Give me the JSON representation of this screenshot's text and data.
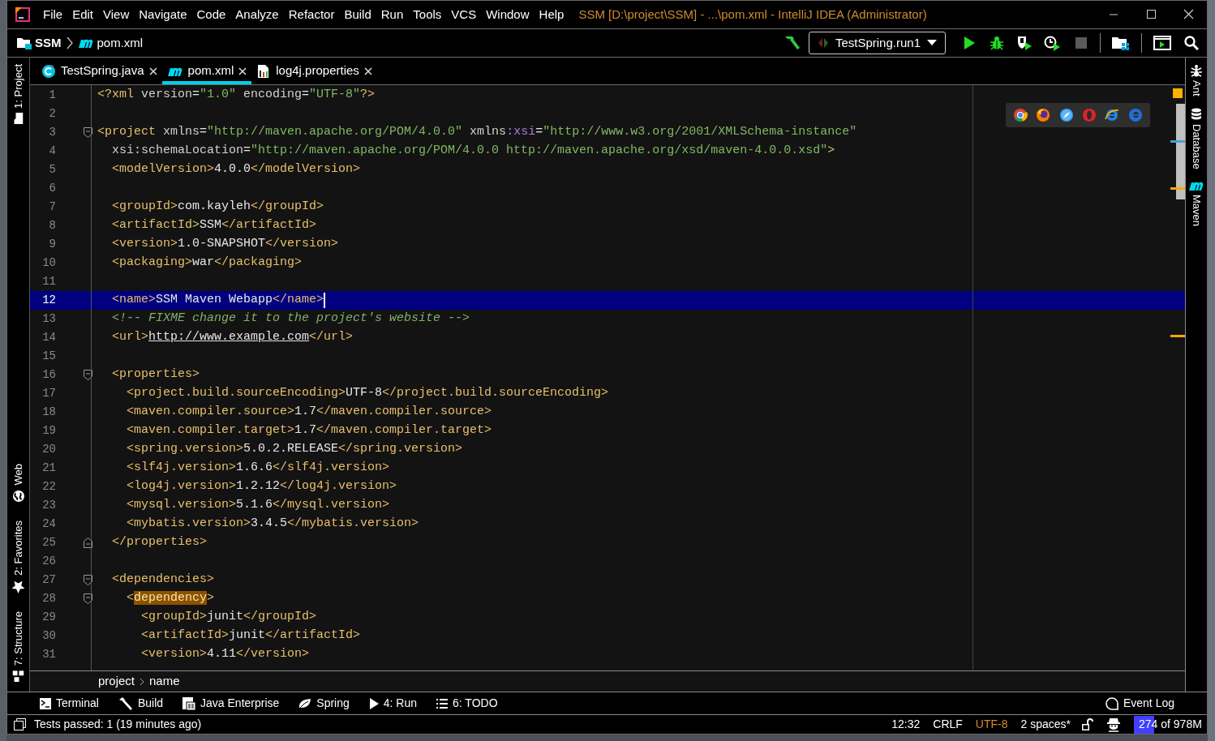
{
  "title_bar": {
    "menu": [
      "File",
      "Edit",
      "View",
      "Navigate",
      "Code",
      "Analyze",
      "Refactor",
      "Build",
      "Run",
      "Tools",
      "VCS",
      "Window",
      "Help"
    ],
    "title": "SSM [D:\\project\\SSM] - ...\\pom.xml - IntelliJ IDEA (Administrator)"
  },
  "nav_bar": {
    "project": "SSM",
    "file": "pom.xml",
    "run_config": "TestSpring.run1",
    "toolbar": [
      {
        "kind": "build",
        "disabled": false
      },
      {
        "kind": "config"
      },
      {
        "kind": "run",
        "disabled": false
      },
      {
        "kind": "debug",
        "disabled": false
      },
      {
        "kind": "coverage",
        "disabled": false
      },
      {
        "kind": "profile",
        "disabled": false
      },
      {
        "kind": "stop",
        "disabled": true
      },
      {
        "kind": "sep"
      },
      {
        "kind": "structure"
      },
      {
        "kind": "sep"
      },
      {
        "kind": "terminal"
      },
      {
        "kind": "search"
      }
    ]
  },
  "tabs": [
    {
      "label": "TestSpring.java",
      "kind": "java",
      "selected": false
    },
    {
      "label": "pom.xml",
      "kind": "maven",
      "selected": true
    },
    {
      "label": "log4j.properties",
      "kind": "properties",
      "selected": false
    }
  ],
  "left_tool_strip": {
    "top": [
      {
        "label": "1: Project",
        "kind": "project"
      }
    ],
    "bottom": [
      {
        "label": "Web",
        "kind": "web"
      },
      {
        "label": "2: Favorites",
        "kind": "favorites"
      },
      {
        "label": "7: Structure",
        "kind": "structure"
      }
    ]
  },
  "right_tool_strip": [
    {
      "label": "Ant",
      "kind": "ant"
    },
    {
      "label": "Database",
      "kind": "database"
    },
    {
      "label": "Maven",
      "kind": "maven"
    }
  ],
  "editor": {
    "browsers": [
      {
        "kind": "chrome"
      },
      {
        "kind": "firefox"
      },
      {
        "kind": "safari"
      },
      {
        "kind": "opera"
      },
      {
        "kind": "ie"
      },
      {
        "kind": "edge"
      }
    ],
    "lines": [
      {
        "number": "1",
        "current": false,
        "caret": false,
        "tokens": [
          {
            "kind": "tag",
            "text": "<?xml "
          },
          {
            "kind": "attr",
            "text": "version"
          },
          {
            "kind": "text",
            "text": "="
          },
          {
            "kind": "value",
            "text": "\"1.0\" "
          },
          {
            "kind": "attr",
            "text": "encoding"
          },
          {
            "kind": "text",
            "text": "="
          },
          {
            "kind": "value",
            "text": "\"UTF-8\""
          },
          {
            "kind": "tag",
            "text": "?>"
          }
        ]
      },
      {
        "number": "2",
        "current": false,
        "caret": false
      },
      {
        "number": "3",
        "kind": "fold_start",
        "current": false,
        "caret": false,
        "tokens": [
          {
            "kind": "tag",
            "text": "<project "
          },
          {
            "kind": "attr",
            "text": "xmlns"
          },
          {
            "kind": "text",
            "text": "="
          },
          {
            "kind": "value",
            "text": "\"http://maven.apache.org/POM/4.0.0\" "
          },
          {
            "kind": "attr",
            "text": "xmlns"
          },
          {
            "kind": "ns",
            "text": ":xsi"
          },
          {
            "kind": "text",
            "text": "="
          },
          {
            "kind": "value",
            "text": "\"http://www.w3.org/2001/XMLSchema-instance\""
          }
        ]
      },
      {
        "number": "4",
        "current": false,
        "caret": false,
        "tokens": [
          {
            "kind": "attr",
            "text": "  xsi:schemaLocation"
          },
          {
            "kind": "text",
            "text": "="
          },
          {
            "kind": "value",
            "text": "\"http://maven.apache.org/POM/4.0.0 http://maven.apache.org/xsd/maven-4.0.0.xsd\""
          },
          {
            "kind": "tag",
            "text": ">"
          }
        ]
      },
      {
        "number": "5",
        "current": false,
        "caret": false,
        "tokens": [
          {
            "kind": "tag",
            "text": "  <modelVersion>"
          },
          {
            "kind": "text",
            "text": "4.0.0"
          },
          {
            "kind": "tag",
            "text": "</modelVersion>"
          }
        ]
      },
      {
        "number": "6",
        "current": false,
        "caret": false
      },
      {
        "number": "7",
        "current": false,
        "caret": false,
        "tokens": [
          {
            "kind": "tag",
            "text": "  <groupId>"
          },
          {
            "kind": "text",
            "text": "com.kayleh"
          },
          {
            "kind": "tag",
            "text": "</groupId>"
          }
        ]
      },
      {
        "number": "8",
        "current": false,
        "caret": false,
        "tokens": [
          {
            "kind": "tag",
            "text": "  <artifactId>"
          },
          {
            "kind": "text",
            "text": "SSM"
          },
          {
            "kind": "tag",
            "text": "</artifactId>"
          }
        ]
      },
      {
        "number": "9",
        "current": false,
        "caret": false,
        "tokens": [
          {
            "kind": "tag",
            "text": "  <version>"
          },
          {
            "kind": "text",
            "text": "1.0-SNAPSHOT"
          },
          {
            "kind": "tag",
            "text": "</version>"
          }
        ]
      },
      {
        "number": "10",
        "current": false,
        "caret": false,
        "tokens": [
          {
            "kind": "tag",
            "text": "  <packaging>"
          },
          {
            "kind": "text",
            "text": "war"
          },
          {
            "kind": "tag",
            "text": "</packaging>"
          }
        ]
      },
      {
        "number": "11",
        "current": false,
        "caret": false
      },
      {
        "number": "12",
        "current": true,
        "caret": true,
        "tokens": [
          {
            "kind": "tag",
            "text": "  <name>"
          },
          {
            "kind": "text",
            "text": "SSM Maven Webapp"
          },
          {
            "kind": "tag",
            "text": "</name>"
          }
        ]
      },
      {
        "number": "13",
        "current": false,
        "caret": false,
        "tokens": [
          {
            "kind": "comment",
            "text": "  <!-- FIXME change it to the project's website -->"
          }
        ]
      },
      {
        "number": "14",
        "current": false,
        "caret": false,
        "tokens": [
          {
            "kind": "tag",
            "text": "  <url>"
          },
          {
            "kind": "link",
            "text": "http://www.example.com"
          },
          {
            "kind": "tag",
            "text": "</url>"
          }
        ]
      },
      {
        "number": "15",
        "current": false,
        "caret": false
      },
      {
        "number": "16",
        "kind": "fold_start",
        "current": false,
        "caret": false,
        "tokens": [
          {
            "kind": "tag",
            "text": "  <properties>"
          }
        ]
      },
      {
        "number": "17",
        "current": false,
        "caret": false,
        "tokens": [
          {
            "kind": "tag",
            "text": "    <project.build.sourceEncoding>"
          },
          {
            "kind": "text",
            "text": "UTF-8"
          },
          {
            "kind": "tag",
            "text": "</project.build.sourceEncoding>"
          }
        ]
      },
      {
        "number": "18",
        "current": false,
        "caret": false,
        "tokens": [
          {
            "kind": "tag",
            "text": "    <maven.compiler.source>"
          },
          {
            "kind": "text",
            "text": "1.7"
          },
          {
            "kind": "tag",
            "text": "</maven.compiler.source>"
          }
        ]
      },
      {
        "number": "19",
        "current": false,
        "caret": false,
        "tokens": [
          {
            "kind": "tag",
            "text": "    <maven.compiler.target>"
          },
          {
            "kind": "text",
            "text": "1.7"
          },
          {
            "kind": "tag",
            "text": "</maven.compiler.target>"
          }
        ]
      },
      {
        "number": "20",
        "current": false,
        "caret": false,
        "tokens": [
          {
            "kind": "tag",
            "text": "    <spring.version>"
          },
          {
            "kind": "text",
            "text": "5.0.2.RELEASE"
          },
          {
            "kind": "tag",
            "text": "</spring.version>"
          }
        ]
      },
      {
        "number": "21",
        "current": false,
        "caret": false,
        "tokens": [
          {
            "kind": "tag",
            "text": "    <slf4j.version>"
          },
          {
            "kind": "text",
            "text": "1.6.6"
          },
          {
            "kind": "tag",
            "text": "</slf4j.version>"
          }
        ]
      },
      {
        "number": "22",
        "current": false,
        "caret": false,
        "tokens": [
          {
            "kind": "tag",
            "text": "    <log4j.version>"
          },
          {
            "kind": "text",
            "text": "1.2.12"
          },
          {
            "kind": "tag",
            "text": "</log4j.version>"
          }
        ]
      },
      {
        "number": "23",
        "current": false,
        "caret": false,
        "tokens": [
          {
            "kind": "tag",
            "text": "    <mysql.version>"
          },
          {
            "kind": "text",
            "text": "5.1.6"
          },
          {
            "kind": "tag",
            "text": "</mysql.version>"
          }
        ]
      },
      {
        "number": "24",
        "current": false,
        "caret": false,
        "tokens": [
          {
            "kind": "tag",
            "text": "    <mybatis.version>"
          },
          {
            "kind": "text",
            "text": "3.4.5"
          },
          {
            "kind": "tag",
            "text": "</mybatis.version>"
          }
        ]
      },
      {
        "number": "25",
        "kind": "fold_end",
        "current": false,
        "caret": false,
        "tokens": [
          {
            "kind": "tag",
            "text": "  </properties>"
          }
        ]
      },
      {
        "number": "26",
        "current": false,
        "caret": false
      },
      {
        "number": "27",
        "kind": "fold_start",
        "current": false,
        "caret": false,
        "tokens": [
          {
            "kind": "tag",
            "text": "  <dependencies>"
          }
        ]
      },
      {
        "number": "28",
        "kind": "fold_start",
        "current": false,
        "caret": false,
        "tokens": [
          {
            "kind": "tag",
            "text": "    <"
          },
          {
            "kind": "match",
            "text": "dependency"
          },
          {
            "kind": "tag",
            "text": ">"
          }
        ]
      },
      {
        "number": "29",
        "current": false,
        "caret": false,
        "tokens": [
          {
            "kind": "tag",
            "text": "      <groupId>"
          },
          {
            "kind": "text",
            "text": "junit"
          },
          {
            "kind": "tag",
            "text": "</groupId>"
          }
        ]
      },
      {
        "number": "30",
        "current": false,
        "caret": false,
        "tokens": [
          {
            "kind": "tag",
            "text": "      <artifactId>"
          },
          {
            "kind": "text",
            "text": "junit"
          },
          {
            "kind": "tag",
            "text": "</artifactId>"
          }
        ]
      },
      {
        "number": "31",
        "current": false,
        "caret": false,
        "tokens": [
          {
            "kind": "tag",
            "text": "      <version>"
          },
          {
            "kind": "text",
            "text": "4.11"
          },
          {
            "kind": "tag",
            "text": "</version>"
          }
        ]
      }
    ]
  },
  "breadcrumb": [
    "project",
    "name"
  ],
  "tool_windows": [
    {
      "label": "Terminal",
      "kind": "terminal"
    },
    {
      "label": "Build",
      "kind": "build"
    },
    {
      "label": "Java Enterprise",
      "kind": "javaee"
    },
    {
      "label": "Spring",
      "kind": "spring"
    },
    {
      "label": "4: Run",
      "kind": "run"
    },
    {
      "label": "6: TODO",
      "kind": "todo"
    }
  ],
  "event_log": "Event Log",
  "status_bar": {
    "message": "Tests passed: 1 (19 minutes ago)",
    "position": "12:32",
    "line_separator": "CRLF",
    "encoding": "UTF-8",
    "indent": "2 spaces*",
    "memory": {
      "text": "274 of 978M",
      "level": 0.28
    }
  }
}
